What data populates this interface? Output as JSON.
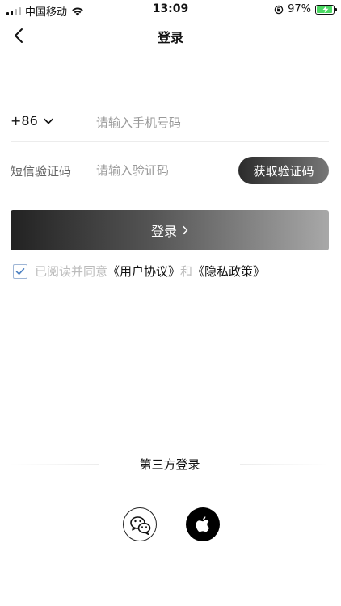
{
  "status_bar": {
    "carrier": "中国移动",
    "time": "13:09",
    "battery": "97%",
    "battery_level": 0.97,
    "battery_color": "#4cd964"
  },
  "nav": {
    "title": "登录",
    "back_icon": "chevron-left-icon"
  },
  "phone": {
    "country_code": "+86",
    "placeholder": "请输入手机号码",
    "value": ""
  },
  "sms": {
    "label": "短信验证码",
    "placeholder": "请输入验证码",
    "value": "",
    "get_code_label": "获取验证码"
  },
  "login_button": {
    "label": "登录"
  },
  "agreement": {
    "checked": true,
    "prefix": "已阅读并同意",
    "user_agreement": "《用户协议》",
    "connector": "和",
    "privacy_policy": "《隐私政策》"
  },
  "third_party": {
    "title": "第三方登录",
    "providers": [
      {
        "icon": "wechat-icon"
      },
      {
        "icon": "apple-icon"
      }
    ]
  },
  "colors": {
    "accent_dark": "#222222",
    "checkbox_border": "#9fb6d6",
    "checkmark": "#4a7fc1"
  }
}
